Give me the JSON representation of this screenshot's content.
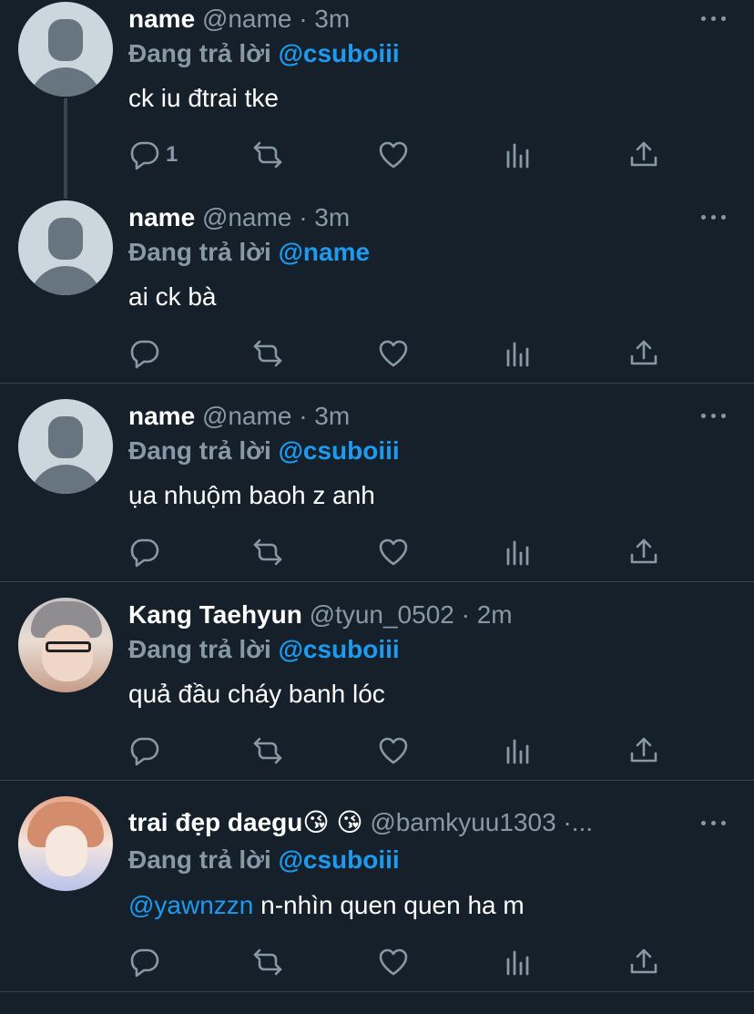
{
  "colors": {
    "background": "#15202b",
    "accent": "#1d9bf0",
    "muted": "#8899a6",
    "divider": "#38444d"
  },
  "icons": {
    "reply": "reply-icon",
    "retweet": "retweet-icon",
    "like": "heart-icon",
    "views": "analytics-icon",
    "share": "share-icon",
    "more": "more-icon"
  },
  "tweets": [
    {
      "display_name": "name",
      "handle": "@name",
      "separator": "·",
      "time": "3m",
      "reply_prefix": "Đang trả lời",
      "reply_to": "@csuboiii",
      "text": "ck iu đtrai tke",
      "reply_count": "1"
    },
    {
      "display_name": "name",
      "handle": "@name",
      "separator": "·",
      "time": "3m",
      "reply_prefix": "Đang trả lời",
      "reply_to": "@name",
      "text": "ai ck bà"
    },
    {
      "display_name": "name",
      "handle": "@name",
      "separator": "·",
      "time": "3m",
      "reply_prefix": "Đang trả lời",
      "reply_to": "@csuboiii",
      "text": "ụa nhuộm baoh z anh"
    },
    {
      "display_name": "Kang Taehyun",
      "handle": "@tyun_0502",
      "separator": "·",
      "time": "2m",
      "reply_prefix": "Đang trả lời",
      "reply_to": "@csuboiii",
      "text": "quả đầu cháy banh lóc"
    },
    {
      "display_name": "trai đẹp daegu😘 😘",
      "handle": "@bamkyuu1303",
      "separator": "·...",
      "reply_prefix": "Đang trả lời",
      "reply_to": "@csuboiii",
      "mention": "@yawnzzn",
      "text": " n-nhìn quen quen ha m"
    }
  ]
}
